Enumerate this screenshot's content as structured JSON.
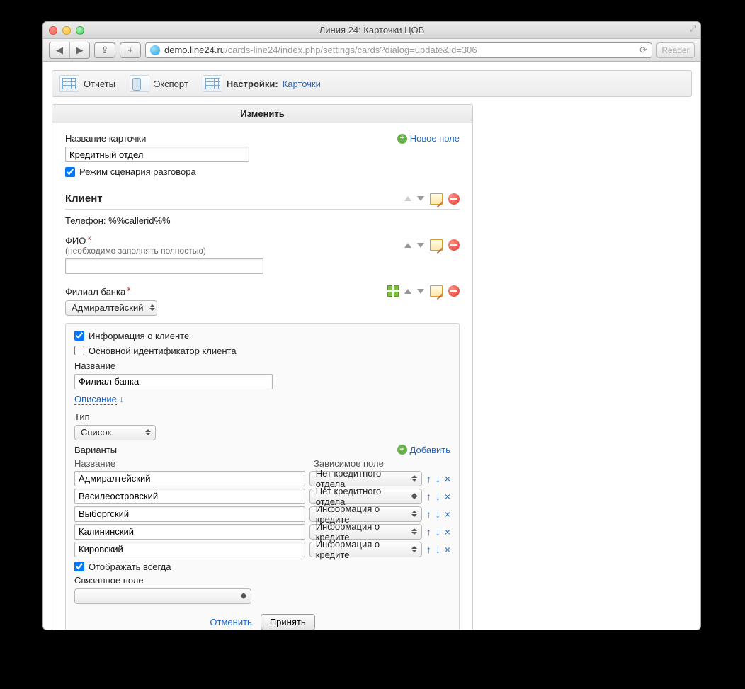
{
  "window": {
    "title": "Линия 24: Карточки ЦОВ"
  },
  "browser": {
    "host": "demo.line24.ru",
    "path": "/cards-line24/index.php/settings/cards?dialog=update&id=306",
    "reader": "Reader"
  },
  "toolbar": {
    "reports": "Отчеты",
    "export": "Экспорт",
    "settings": "Настройки:",
    "crumb": "Карточки"
  },
  "panel": {
    "title": "Изменить"
  },
  "card": {
    "name_label": "Название карточки",
    "name_value": "Кредитный отдел",
    "new_field": "Новое поле",
    "scenario_mode": "Режим сценария разговора"
  },
  "client": {
    "section": "Клиент",
    "phone_label": "Телефон:",
    "phone_value": "%%callerid%%",
    "fio_label": "ФИО",
    "fio_hint": "(необходимо заполнять полностью)"
  },
  "branch": {
    "label": "Филиал банка",
    "selected": "Адмиралтейский"
  },
  "editor": {
    "client_info": "Информация о клиенте",
    "primary_id": "Основной идентификатор клиента",
    "name_label": "Название",
    "name_value": "Филиал банка",
    "description": "Описание",
    "type_label": "Тип",
    "type_value": "Список",
    "variants_label": "Варианты",
    "add": "Добавить",
    "col_name": "Название",
    "col_dep": "Зависимое поле",
    "variants": [
      {
        "name": "Адмиралтейский",
        "dep": "Нет кредитного отдела"
      },
      {
        "name": "Василеостровский",
        "dep": "Нет кредитного отдела"
      },
      {
        "name": "Выборгский",
        "dep": "Информация о кредите"
      },
      {
        "name": "Калининский",
        "dep": "Информация о кредите"
      },
      {
        "name": "Кировский",
        "dep": "Информация о кредите"
      }
    ],
    "always_show": "Отображать всегда",
    "linked_label": "Связанное поле",
    "cancel": "Отменить",
    "accept": "Принять"
  }
}
